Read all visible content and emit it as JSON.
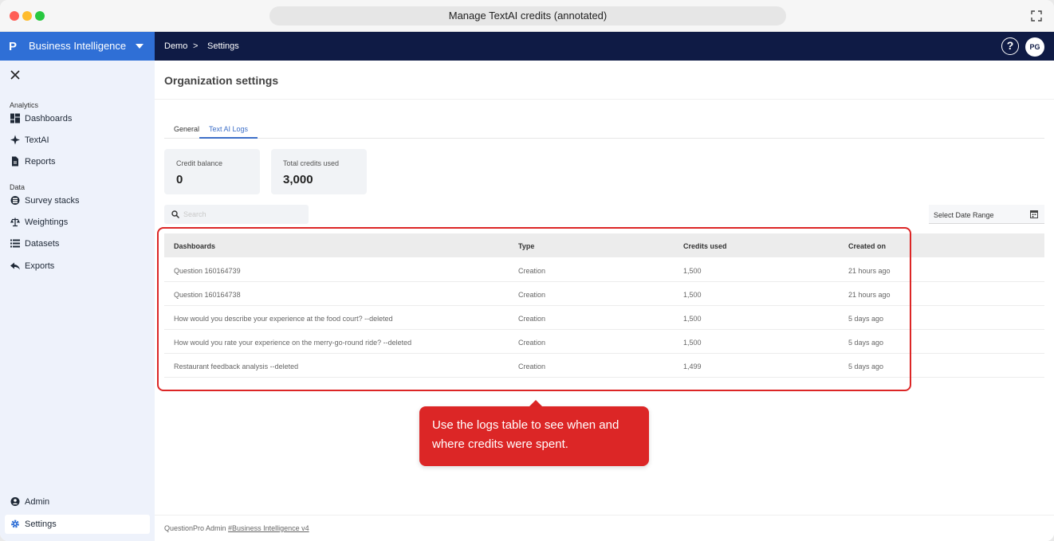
{
  "window": {
    "title": "Manage TextAI credits (annotated)"
  },
  "sidebar": {
    "brand_logo": "P",
    "brand_name": "Business Intelligence",
    "sections": [
      {
        "label": "Analytics",
        "items": [
          {
            "label": "Dashboards",
            "icon": "dashboard-icon"
          },
          {
            "label": "TextAI",
            "icon": "sparkle-icon"
          },
          {
            "label": "Reports",
            "icon": "document-icon"
          }
        ]
      },
      {
        "label": "Data",
        "items": [
          {
            "label": "Survey stacks",
            "icon": "stack-icon"
          },
          {
            "label": "Weightings",
            "icon": "scale-icon"
          },
          {
            "label": "Datasets",
            "icon": "list-icon"
          },
          {
            "label": "Exports",
            "icon": "export-icon"
          }
        ]
      }
    ],
    "bottom": [
      {
        "label": "Admin",
        "icon": "shield-user-icon"
      },
      {
        "label": "Settings",
        "icon": "gear-icon",
        "active": true
      }
    ]
  },
  "topnav": {
    "crumb_1": "Demo",
    "separator": ">",
    "crumb_2": "Settings",
    "help": "?",
    "avatar": "PG"
  },
  "page": {
    "title": "Organization settings",
    "tabs": [
      {
        "label": "General"
      },
      {
        "label": "Text AI Logs",
        "active": true
      }
    ],
    "cards": [
      {
        "label": "Credit balance",
        "value": "0"
      },
      {
        "label": "Total credits used",
        "value": "3,000"
      }
    ],
    "search_placeholder": "Search",
    "date_range_label": "Select Date Range",
    "table": {
      "columns": [
        "Dashboards",
        "Type",
        "Credits used",
        "Created on"
      ],
      "rows": [
        [
          "Question 160164739",
          "Creation",
          "1,500",
          "21 hours ago"
        ],
        [
          "Question 160164738",
          "Creation",
          "1,500",
          "21 hours ago"
        ],
        [
          "How would you describe your experience at the food court? --deleted",
          "Creation",
          "1,500",
          "5 days ago"
        ],
        [
          "How would you rate your experience on the merry-go-round ride? --deleted",
          "Creation",
          "1,500",
          "5 days ago"
        ],
        [
          "Restaurant feedback analysis --deleted",
          "Creation",
          "1,499",
          "5 days ago"
        ]
      ]
    }
  },
  "annotation": {
    "text": "Use the logs table to see when and where credits were spent.",
    "color": "#dc2626"
  },
  "footer": {
    "prefix": "QuestionPro Admin ",
    "link": "#Business Intelligence v4"
  },
  "colors": {
    "brand": "#2f6fd6",
    "topnav": "#0f1b45",
    "sidebar_bg": "#eef2fb",
    "accent": "#3d6fc8"
  }
}
